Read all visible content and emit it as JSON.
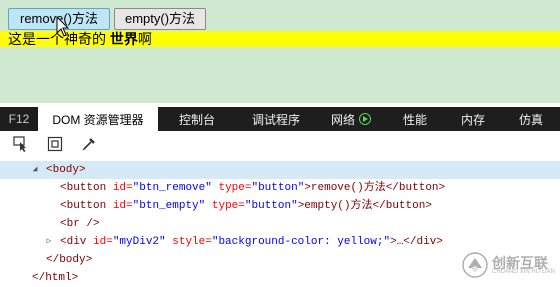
{
  "page": {
    "remove_button": "remove()方法",
    "empty_button": "empty()方法",
    "div_text_normal": "这是一个神奇的 ",
    "div_text_bold": "世界",
    "div_text_tail": "啊"
  },
  "devtools": {
    "tabs": [
      "F12",
      "DOM 资源管理器",
      "控制台",
      "调试程序",
      "网络",
      "性能",
      "内存",
      "仿真"
    ],
    "active_tab": "DOM 资源管理器"
  },
  "dom_tree": {
    "body_open": "<body>",
    "btn1": {
      "open": "<button",
      "id_attr": "id=",
      "id_val": "\"btn_remove\"",
      "type_attr": "type=",
      "type_val": "\"button\"",
      "text": ">remove()方法</button>"
    },
    "btn2": {
      "open": "<button",
      "id_attr": "id=",
      "id_val": "\"btn_empty\"",
      "type_attr": "type=",
      "type_val": "\"button\"",
      "text": ">empty()方法</button>"
    },
    "br": "<br />",
    "div": {
      "open": "<div",
      "id_attr": "id=",
      "id_val": "\"myDiv2\"",
      "style_attr": "style=",
      "style_val": "\"background-color: yellow;\"",
      "text": ">…</div>"
    },
    "body_close": "</body>",
    "html_close": "</html>"
  },
  "watermark": {
    "title": "创新互联",
    "subtitle": "CHUANG XIN HU LIAN"
  },
  "colors": {
    "page_bg": "#cfe8d0",
    "highlight": "#ffff00",
    "tabbar_bg": "#1e1e1e",
    "selected_row": "#d6e9f6"
  }
}
